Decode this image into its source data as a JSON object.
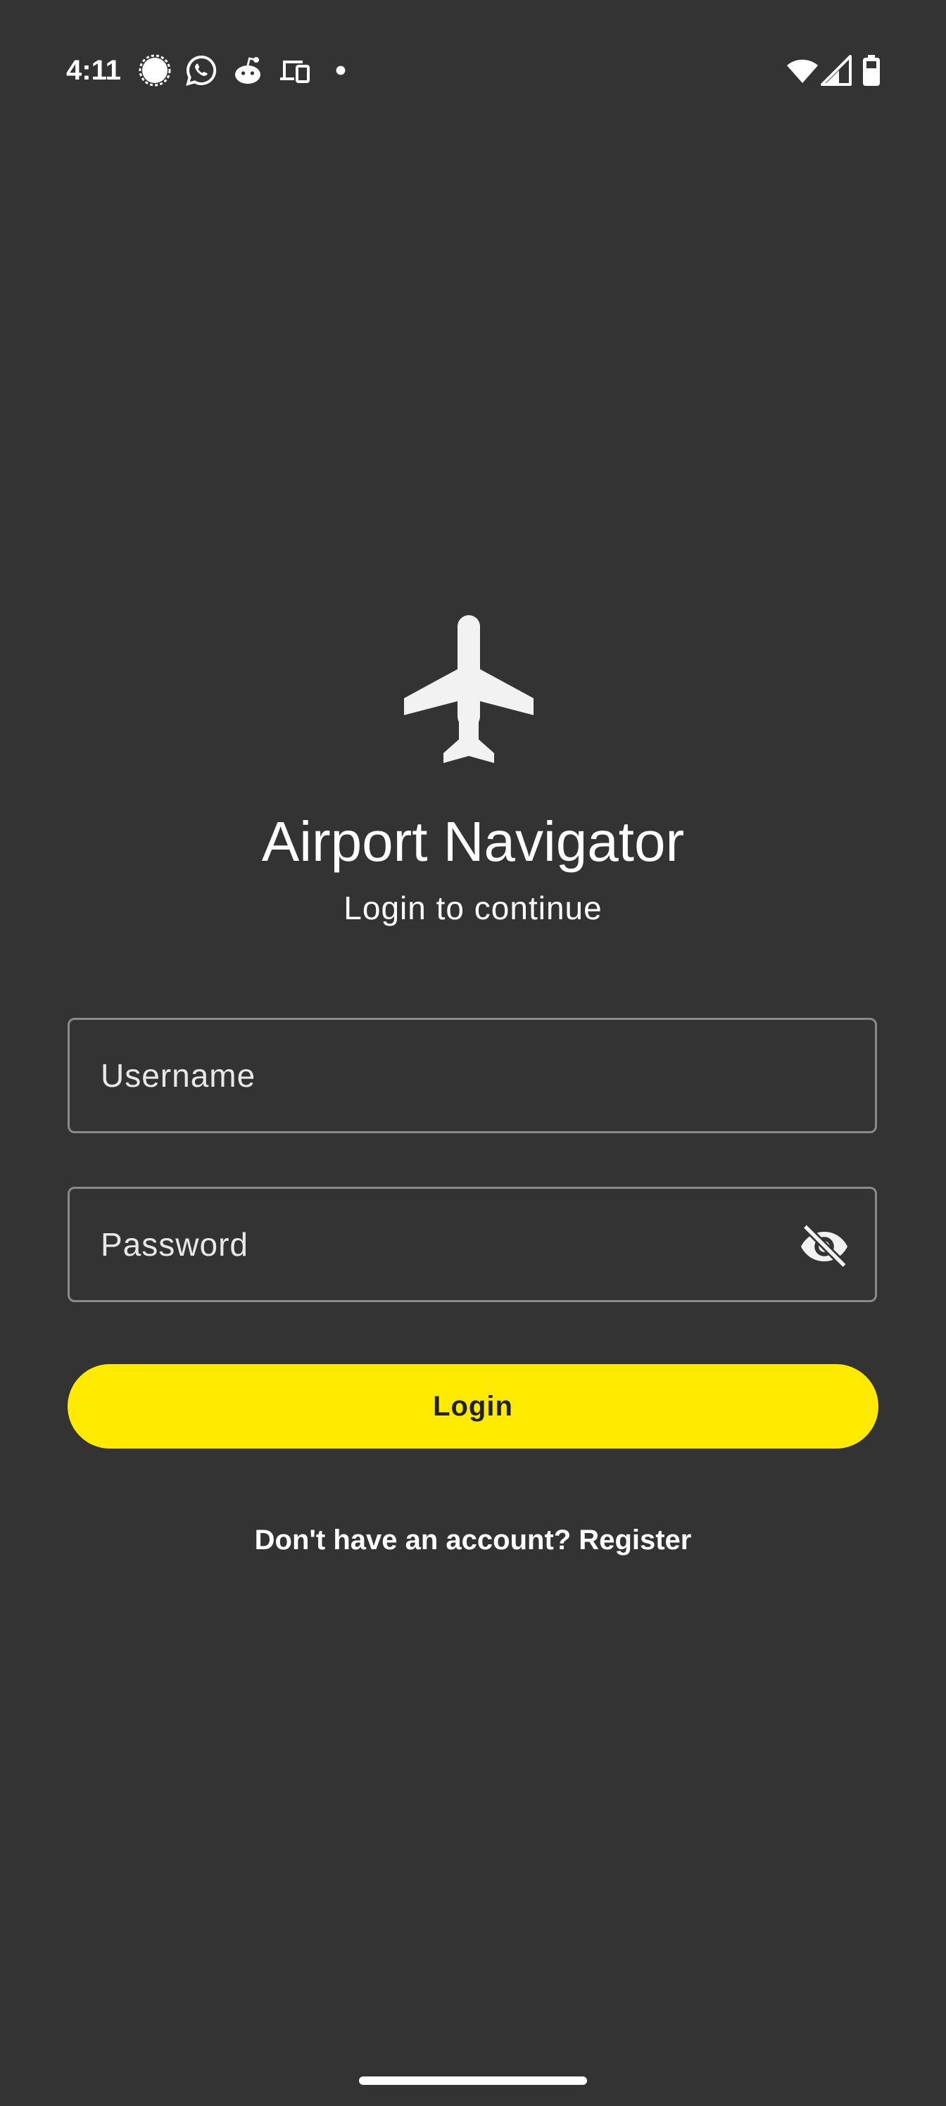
{
  "status_bar": {
    "time": "4:11",
    "left_icons": [
      "signal-app-icon",
      "whatsapp-icon",
      "reddit-icon",
      "devices-icon",
      "dot-icon"
    ],
    "right_icons": [
      "wifi-icon",
      "cellular-icon",
      "battery-icon"
    ]
  },
  "app": {
    "logo_icon": "airplane-icon",
    "title": "Airport Navigator",
    "subtitle": "Login to continue"
  },
  "form": {
    "username": {
      "placeholder": "Username",
      "value": ""
    },
    "password": {
      "placeholder": "Password",
      "value": "",
      "toggle_icon": "eye-off-icon"
    },
    "login_label": "Login",
    "register_text": "Don't have an account? Register"
  },
  "colors": {
    "background": "#333333",
    "accent": "#ffea00",
    "text": "#ffffff",
    "field_border": "#8a8a8a"
  }
}
